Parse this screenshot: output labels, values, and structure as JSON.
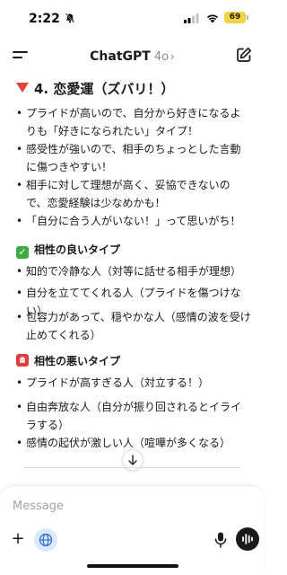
{
  "status_bar": {
    "time": "2:22",
    "battery": "69"
  },
  "header": {
    "title": "ChatGPT",
    "model": "4o",
    "chevron": "›"
  },
  "content": {
    "section_title": "4. 恋愛運（ズバリ！）",
    "section_items": [
      "プライドが高いので、自分から好きになるよりも「好きになられたい」タイプ！",
      "感受性が強いので、相手のちょっとした言動に傷つきやすい！",
      "相手に対して理想が高く、妥協できないので、恋愛経験は少なめかも！",
      "「自分に合う人がいない！」って思いがち！"
    ],
    "good_title": "相性の良いタイプ",
    "good_items": [
      "知的で冷静な人（対等に話せる相手が理想）",
      "自分を立ててくれる人（プライドを傷つけない）",
      "包容力があって、穏やかな人（感情の波を受け止めてくれる）"
    ],
    "bad_title": "相性の悪いタイプ",
    "bad_items": [
      "プライドが高すぎる人（対立する！）",
      "自由奔放な人（自分が振り回されるとイライラする）",
      "感情の起伏が激しい人（喧嘩が多くなる）"
    ]
  },
  "composer": {
    "placeholder": "Message",
    "plus": "+"
  },
  "icons": {
    "menu": "menu-icon",
    "compose": "compose-icon",
    "scroll": "arrow-down-icon",
    "globe": "globe-icon",
    "mic": "microphone-icon",
    "voice": "voice-mode-icon",
    "triangle": "red-triangle-icon",
    "check": "check-mark-icon",
    "siren": "siren-icon"
  },
  "colors": {
    "accent_globe_bg": "#dbeafd",
    "check_green": "#3dab42",
    "alert_red": "#e23b3b",
    "battery_yellow": "#f0d33f"
  }
}
